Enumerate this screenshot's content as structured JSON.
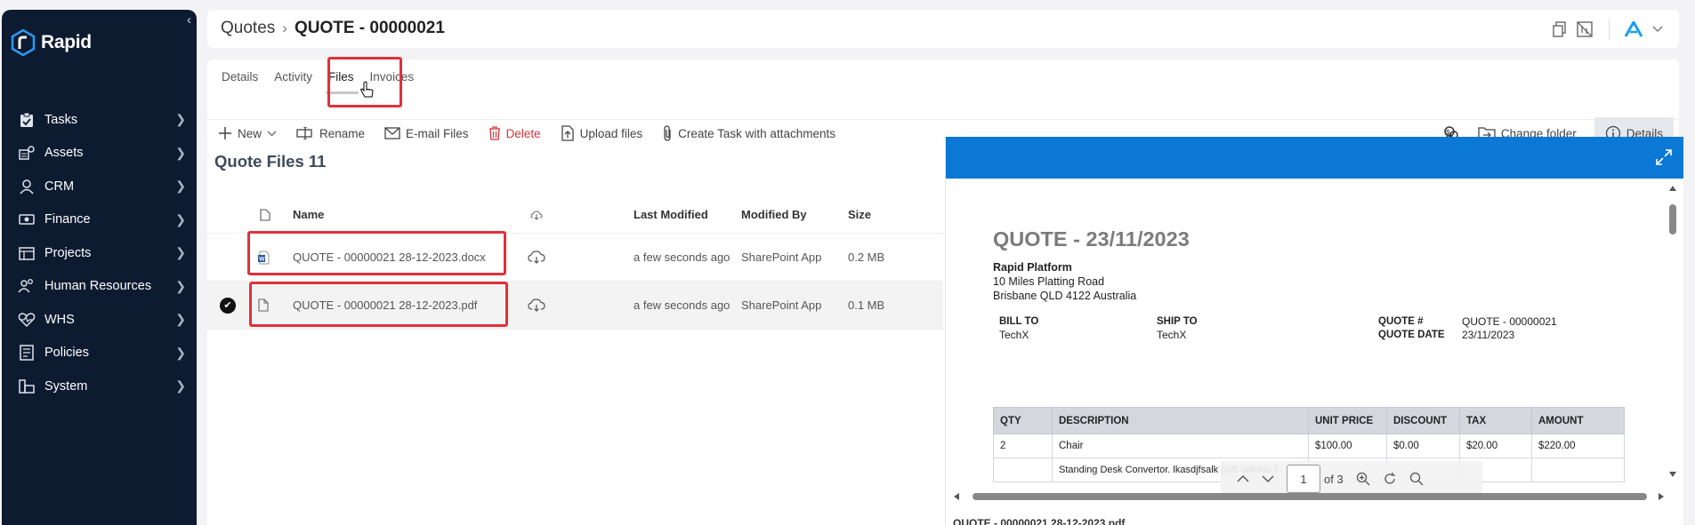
{
  "sidebar": {
    "logo_text": "Rapid",
    "collapse_glyph": "‹",
    "items": [
      {
        "label": "Tasks",
        "icon": "clipboard-icon"
      },
      {
        "label": "Assets",
        "icon": "assets-icon"
      },
      {
        "label": "CRM",
        "icon": "person-icon"
      },
      {
        "label": "Finance",
        "icon": "money-icon"
      },
      {
        "label": "Projects",
        "icon": "projects-icon"
      },
      {
        "label": "Human Resources",
        "icon": "people-icon"
      },
      {
        "label": "WHS",
        "icon": "heart-pulse-icon"
      },
      {
        "label": "Policies",
        "icon": "book-icon"
      },
      {
        "label": "System",
        "icon": "system-icon"
      }
    ]
  },
  "header": {
    "breadcrumb_root": "Quotes",
    "breadcrumb_sep": "›",
    "breadcrumb_current": "QUOTE - 00000021"
  },
  "tabs": [
    "Details",
    "Activity",
    "Files",
    "Invoices"
  ],
  "active_tab": "Files",
  "toolbar": {
    "new": "New",
    "rename": "Rename",
    "email": "E-mail Files",
    "delete": "Delete",
    "upload": "Upload files",
    "create_task": "Create Task with attachments",
    "change_folder": "Change folder",
    "details": "Details"
  },
  "files": {
    "title": "Quote Files 11",
    "columns": {
      "name": "Name",
      "last_modified": "Last Modified",
      "modified_by": "Modified By",
      "size": "Size"
    },
    "rows": [
      {
        "name": "QUOTE - 00000021 28-12-2023.docx",
        "last_modified": "a few seconds ago",
        "modified_by": "SharePoint App",
        "size": "0.2 MB",
        "type": "word-doc-icon",
        "selected": false
      },
      {
        "name": "QUOTE - 00000021 28-12-2023.pdf",
        "last_modified": "a few seconds ago",
        "modified_by": "SharePoint App",
        "size": "0.1 MB",
        "type": "file-icon",
        "selected": true
      }
    ]
  },
  "preview": {
    "heading": "QUOTE - 23/11/2023",
    "company_name": "Rapid Platform",
    "address_line1": "10 Miles Platting Road",
    "address_line2": "Brisbane QLD 4122 Australia",
    "bill_to_label": "BILL TO",
    "bill_to_value": "TechX",
    "ship_to_label": "SHIP TO",
    "ship_to_value": "TechX",
    "quote_no_label": "QUOTE #",
    "quote_no_value": "QUOTE - 00000021",
    "quote_date_label": "QUOTE DATE",
    "quote_date_value": "23/11/2023",
    "table_headers": [
      "QTY",
      "DESCRIPTION",
      "UNIT PRICE",
      "DISCOUNT",
      "TAX",
      "AMOUNT"
    ],
    "table_rows": [
      [
        "2",
        "Chair",
        "$100.00",
        "$0.00",
        "$20.00",
        "$220.00"
      ],
      [
        "",
        "Standing Desk Convertor. lkasdjfsalk jsdfl sdikfds f",
        "",
        "",
        "",
        ""
      ]
    ],
    "page_current": "1",
    "page_total": "of 3",
    "caption": "QUOTE - 00000021 28-12-2023.pdf"
  },
  "colors": {
    "accent": "#0a78d4",
    "highlight": "#e0313a",
    "sidebar": "#0d1b31",
    "danger": "#d13438"
  }
}
